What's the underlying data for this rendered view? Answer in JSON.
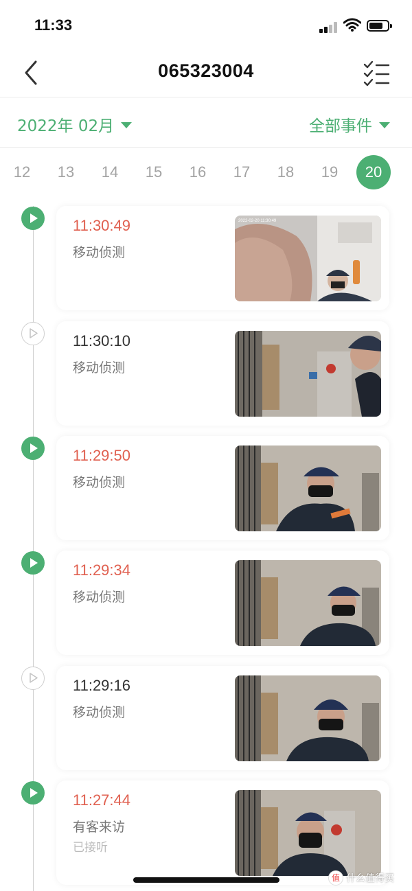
{
  "status_bar": {
    "time": "11:33"
  },
  "header": {
    "title": "065323004"
  },
  "filters": {
    "date_label": "2022年 02月",
    "event_label": "全部事件"
  },
  "days": [
    "12",
    "13",
    "14",
    "15",
    "16",
    "17",
    "18",
    "19",
    "20"
  ],
  "selected_day": "20",
  "events": [
    {
      "time": "11:30:49",
      "type": "移动侦测",
      "status": "",
      "unread": true,
      "thumb_timestamp": "2022-02-20  11:30:49"
    },
    {
      "time": "11:30:10",
      "type": "移动侦测",
      "status": "",
      "unread": false
    },
    {
      "time": "11:29:50",
      "type": "移动侦测",
      "status": "",
      "unread": true
    },
    {
      "time": "11:29:34",
      "type": "移动侦测",
      "status": "",
      "unread": true
    },
    {
      "time": "11:29:16",
      "type": "移动侦测",
      "status": "",
      "unread": false
    },
    {
      "time": "11:27:44",
      "type": "有客来访",
      "status": "已接听",
      "unread": true
    }
  ],
  "watermark": {
    "text": "什么值得买",
    "badge": "值"
  },
  "colors": {
    "accent": "#4caf73",
    "unread_time": "#e06050"
  }
}
